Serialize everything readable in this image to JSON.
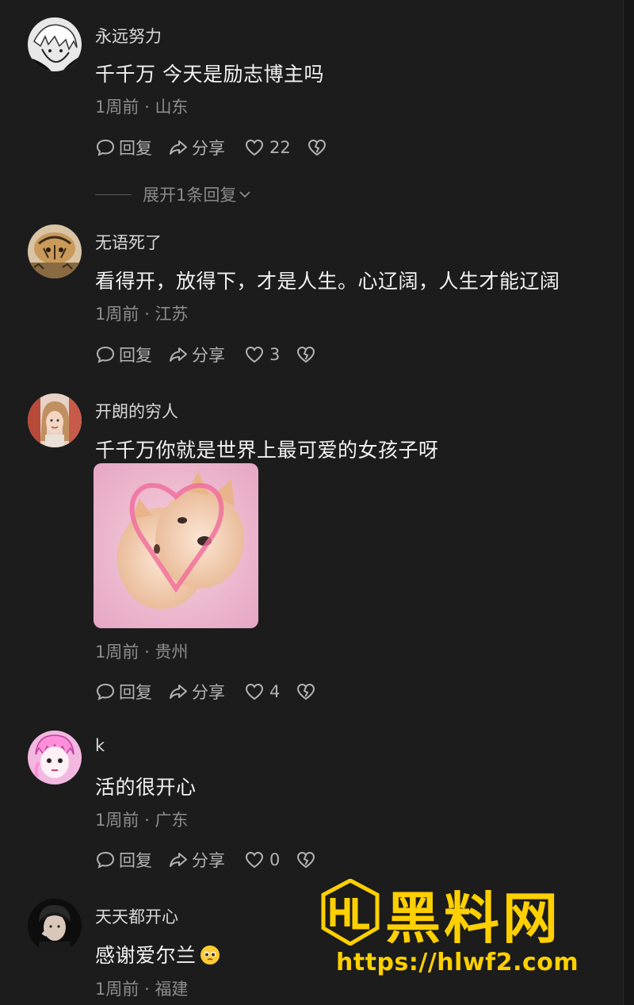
{
  "comments": [
    {
      "username": "永远努力",
      "text": "千千万 今天是励志博主吗",
      "time": "1周前",
      "location": "山东",
      "reply_label": "回复",
      "share_label": "分享",
      "likes": "22",
      "expand_label": "展开1条回复"
    },
    {
      "username": "无语死了",
      "text": "看得开，放得下，才是人生。心辽阔，人生才能辽阔",
      "time": "1周前",
      "location": "江苏",
      "reply_label": "回复",
      "share_label": "分享",
      "likes": "3"
    },
    {
      "username": "开朗的穷人",
      "text": "千千万你就是世界上最可爱的女孩子呀",
      "time": "1周前",
      "location": "贵州",
      "reply_label": "回复",
      "share_label": "分享",
      "likes": "4"
    },
    {
      "username": "k",
      "text": "活的很开心",
      "time": "1周前",
      "location": "广东",
      "reply_label": "回复",
      "share_label": "分享",
      "likes": "0"
    },
    {
      "username": "天天都开心",
      "text": "感谢爱尔兰",
      "time": "1周前",
      "location": "福建"
    }
  ],
  "meta_separator": "·",
  "watermark": {
    "logo_text": "HL",
    "title": "黑料网",
    "url": "https://hlwf2.com"
  },
  "icons": {
    "reply": "comment-bubble-icon",
    "share": "share-arrow-icon",
    "like": "heart-outline-icon",
    "dislike": "broken-heart-icon",
    "expand": "chevron-down-icon"
  },
  "colors": {
    "background": "#1c1c1c",
    "text": "#f2f2f2",
    "meta": "#8d8d8d",
    "watermark": "#ffd000"
  }
}
